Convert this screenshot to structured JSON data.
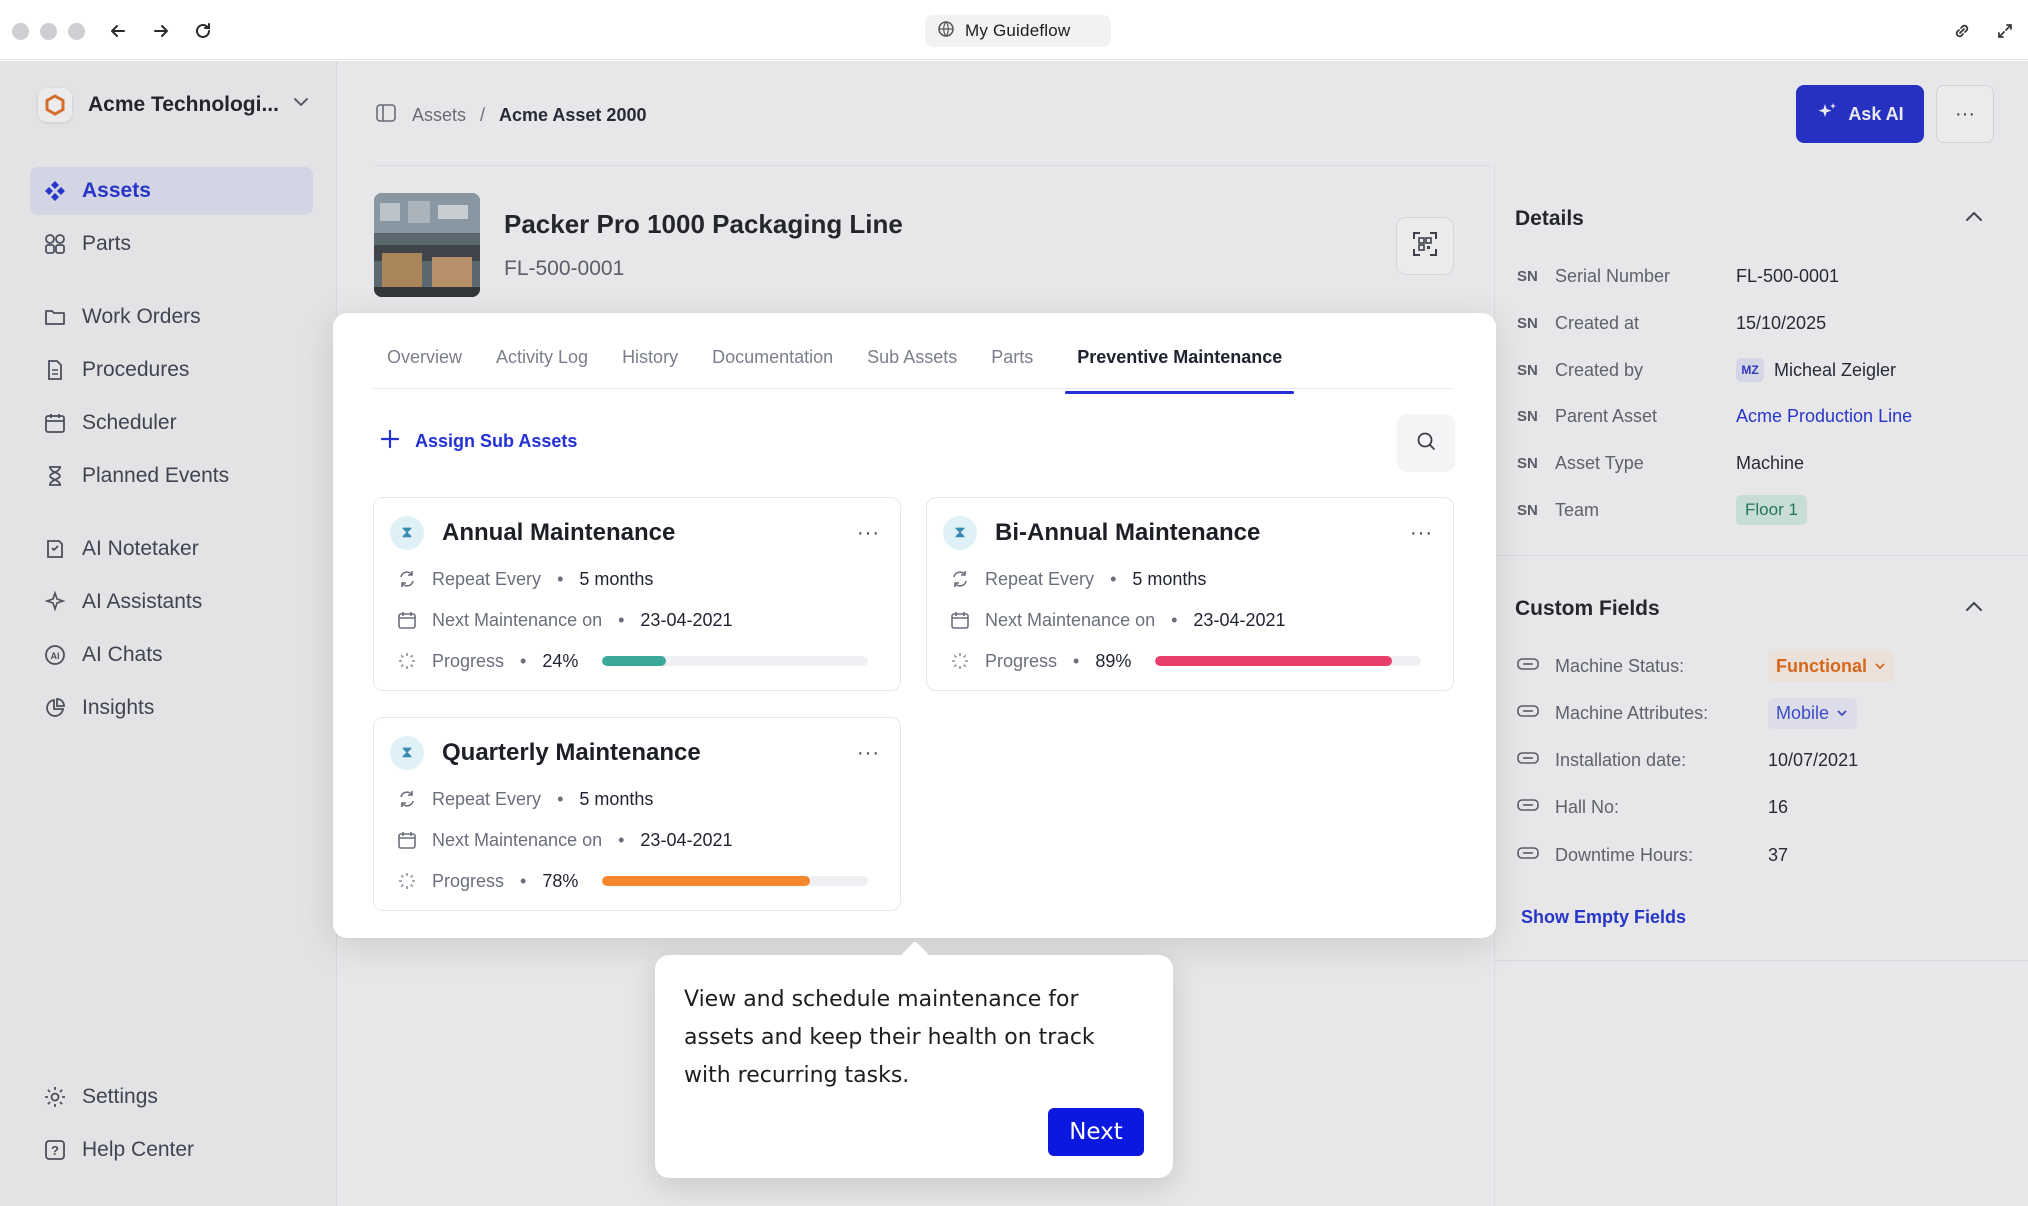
{
  "browser": {
    "url_title": "My Guideflow"
  },
  "sidebar": {
    "org_name": "Acme Technologi...",
    "items": [
      {
        "label": "Assets",
        "icon": "assets-icon",
        "active": true
      },
      {
        "label": "Parts",
        "icon": "parts-icon"
      },
      {
        "label": "Work Orders",
        "icon": "folder-icon"
      },
      {
        "label": "Procedures",
        "icon": "document-icon"
      },
      {
        "label": "Scheduler",
        "icon": "calendar-icon"
      },
      {
        "label": "Planned Events",
        "icon": "hourglass-icon"
      },
      {
        "label": "AI Notetaker",
        "icon": "notetaker-icon"
      },
      {
        "label": "AI Assistants",
        "icon": "sparkle-icon"
      },
      {
        "label": "AI Chats",
        "icon": "ai-chat-icon"
      },
      {
        "label": "Insights",
        "icon": "chart-icon"
      }
    ],
    "footer": [
      {
        "label": "Settings",
        "icon": "gear-icon"
      },
      {
        "label": "Help Center",
        "icon": "help-icon"
      }
    ]
  },
  "header": {
    "breadcrumb_root": "Assets",
    "breadcrumb_sep": "/",
    "breadcrumb_current": "Acme Asset 2000",
    "ask_ai_label": "Ask AI",
    "more_label": "···"
  },
  "asset": {
    "title": "Packer Pro 1000 Packaging Line",
    "code": "FL-500-0001"
  },
  "tabs": [
    {
      "label": "Overview"
    },
    {
      "label": "Activity Log"
    },
    {
      "label": "History"
    },
    {
      "label": "Documentation"
    },
    {
      "label": "Sub Assets"
    },
    {
      "label": "Parts"
    },
    {
      "label": "Preventive Maintenance",
      "active": true
    }
  ],
  "toolbar": {
    "assign_label": "Assign Sub Assets"
  },
  "maintenance": [
    {
      "title": "Annual Maintenance",
      "repeat_label": "Repeat Every",
      "repeat_value": "5 months",
      "next_label": "Next Maintenance on",
      "next_value": "23-04-2021",
      "progress_label": "Progress",
      "progress_text": "24%",
      "progress": 0.24,
      "color": "#3aa99a"
    },
    {
      "title": "Bi-Annual Maintenance",
      "repeat_label": "Repeat Every",
      "repeat_value": "5 months",
      "next_label": "Next Maintenance on",
      "next_value": "23-04-2021",
      "progress_label": "Progress",
      "progress_text": "89%",
      "progress": 0.89,
      "color": "#e83e6a"
    },
    {
      "title": "Quarterly Maintenance",
      "repeat_label": "Repeat Every",
      "repeat_value": "5 months",
      "next_label": "Next Maintenance on",
      "next_value": "23-04-2021",
      "progress_label": "Progress",
      "progress_text": "78%",
      "progress": 0.78,
      "color": "#f5872e"
    }
  ],
  "details": {
    "title": "Details",
    "rows": [
      {
        "tag": "SN",
        "label": "Serial Number",
        "value": "FL-500-0001"
      },
      {
        "tag": "SN",
        "label": "Created at",
        "value": "15/10/2025"
      },
      {
        "tag": "SN",
        "label": "Created by",
        "value": "Micheal Zeigler",
        "avatar": "MZ"
      },
      {
        "tag": "SN",
        "label": "Parent Asset",
        "value": "Acme Production Line"
      },
      {
        "tag": "SN",
        "label": "Asset Type",
        "value": "Machine"
      },
      {
        "tag": "SN",
        "label": "Team",
        "value": "Floor 1"
      }
    ]
  },
  "custom_fields": {
    "title": "Custom Fields",
    "rows": [
      {
        "label": "Machine Status:",
        "value": "Functional"
      },
      {
        "label": "Machine Attributes:",
        "value": "Mobile"
      },
      {
        "label": "Installation date:",
        "value": "10/07/2021"
      },
      {
        "label": "Hall No:",
        "value": "16"
      },
      {
        "label": "Downtime Hours:",
        "value": "37"
      }
    ],
    "show_empty": "Show Empty Fields"
  },
  "tooltip": {
    "text": "View and schedule maintenance for assets and keep their health on track with recurring tasks.",
    "next_label": "Next"
  },
  "colors": {
    "accent": "#2131d6",
    "ask_ai_bg": "#1f2ccf",
    "next_bg": "#0a18e0"
  }
}
